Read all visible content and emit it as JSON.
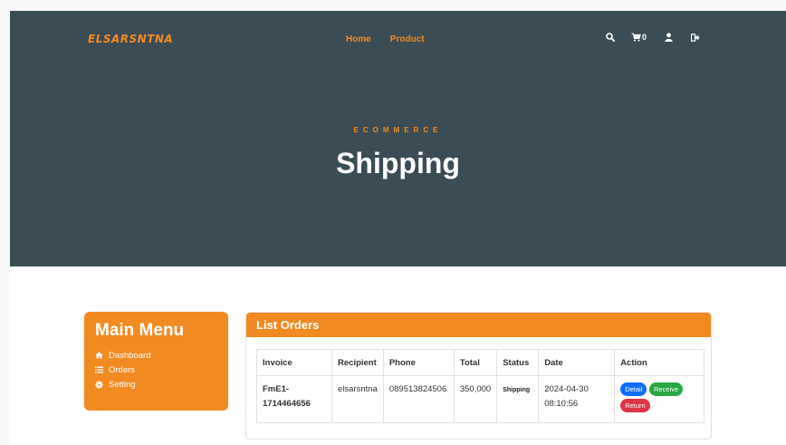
{
  "header": {
    "logo": "ELSARSNTNA",
    "nav": [
      "Home",
      "Product"
    ],
    "cart_count": "0"
  },
  "hero": {
    "eyebrow": "ECOMMERCE",
    "title": "Shipping"
  },
  "colors": {
    "accent": "#f28a22",
    "hero_bg": "#3b4c55",
    "detail": "#0d6efd",
    "receive": "#28a745",
    "return": "#dc3545"
  },
  "menu": {
    "title": "Main Menu",
    "items": [
      {
        "label": "Dashboard",
        "icon": "home-icon"
      },
      {
        "label": "Orders",
        "icon": "list-icon"
      },
      {
        "label": "Setting",
        "icon": "gear-icon"
      }
    ]
  },
  "orders": {
    "title": "List Orders",
    "columns": [
      "Invoice",
      "Recipient",
      "Phone",
      "Total",
      "Status",
      "Date",
      "Action"
    ],
    "rows": [
      {
        "invoice_1": "FmE1-",
        "invoice_2": "1714464656",
        "recipient": "elsarsntna",
        "phone": "089513824506",
        "total": "350,000",
        "status": "Shipping",
        "date_1": "2024-04-30",
        "date_2": "08:10:56",
        "actions": {
          "detail": "Detail",
          "receive": "Receive",
          "return": "Return"
        }
      }
    ]
  }
}
